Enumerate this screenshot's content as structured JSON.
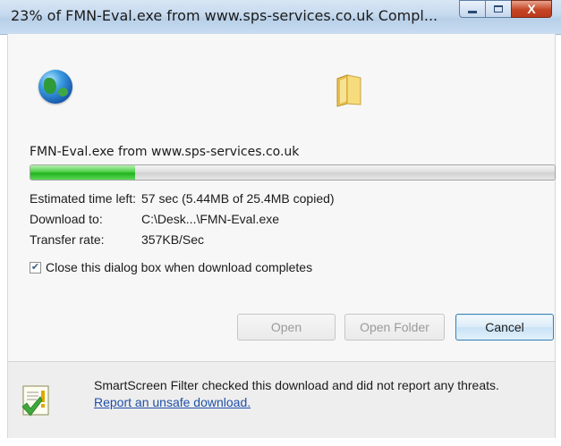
{
  "window": {
    "title": "23% of FMN-Eval.exe from www.sps-services.co.uk Compl...",
    "minimize_label": "minimize",
    "maximize_label": "maximize",
    "close_glyph": "X"
  },
  "icons": {
    "source": "globe-icon",
    "destination": "folder-icon",
    "smartscreen": "smartscreen-shield-icon"
  },
  "download": {
    "file_line": "FMN-Eval.exe from www.sps-services.co.uk",
    "progress_fraction": 0.2,
    "rows": [
      {
        "label": "Estimated time left:",
        "value": "57 sec (5.44MB of 25.4MB copied)"
      },
      {
        "label": "Download to:",
        "value": "C:\\Desk...\\FMN-Eval.exe"
      },
      {
        "label": "Transfer rate:",
        "value": "357KB/Sec"
      }
    ]
  },
  "options": {
    "close_when_done_label": "Close this dialog box when download completes",
    "close_when_done_checked": true
  },
  "buttons": {
    "open": "Open",
    "open_folder": "Open Folder",
    "cancel": "Cancel"
  },
  "footer": {
    "text": "SmartScreen Filter checked this download and did not report any threats.",
    "link": "Report an unsafe download."
  },
  "colors": {
    "progress": "#21b31e",
    "link": "#1f4fa8",
    "close_button": "#c54526"
  }
}
